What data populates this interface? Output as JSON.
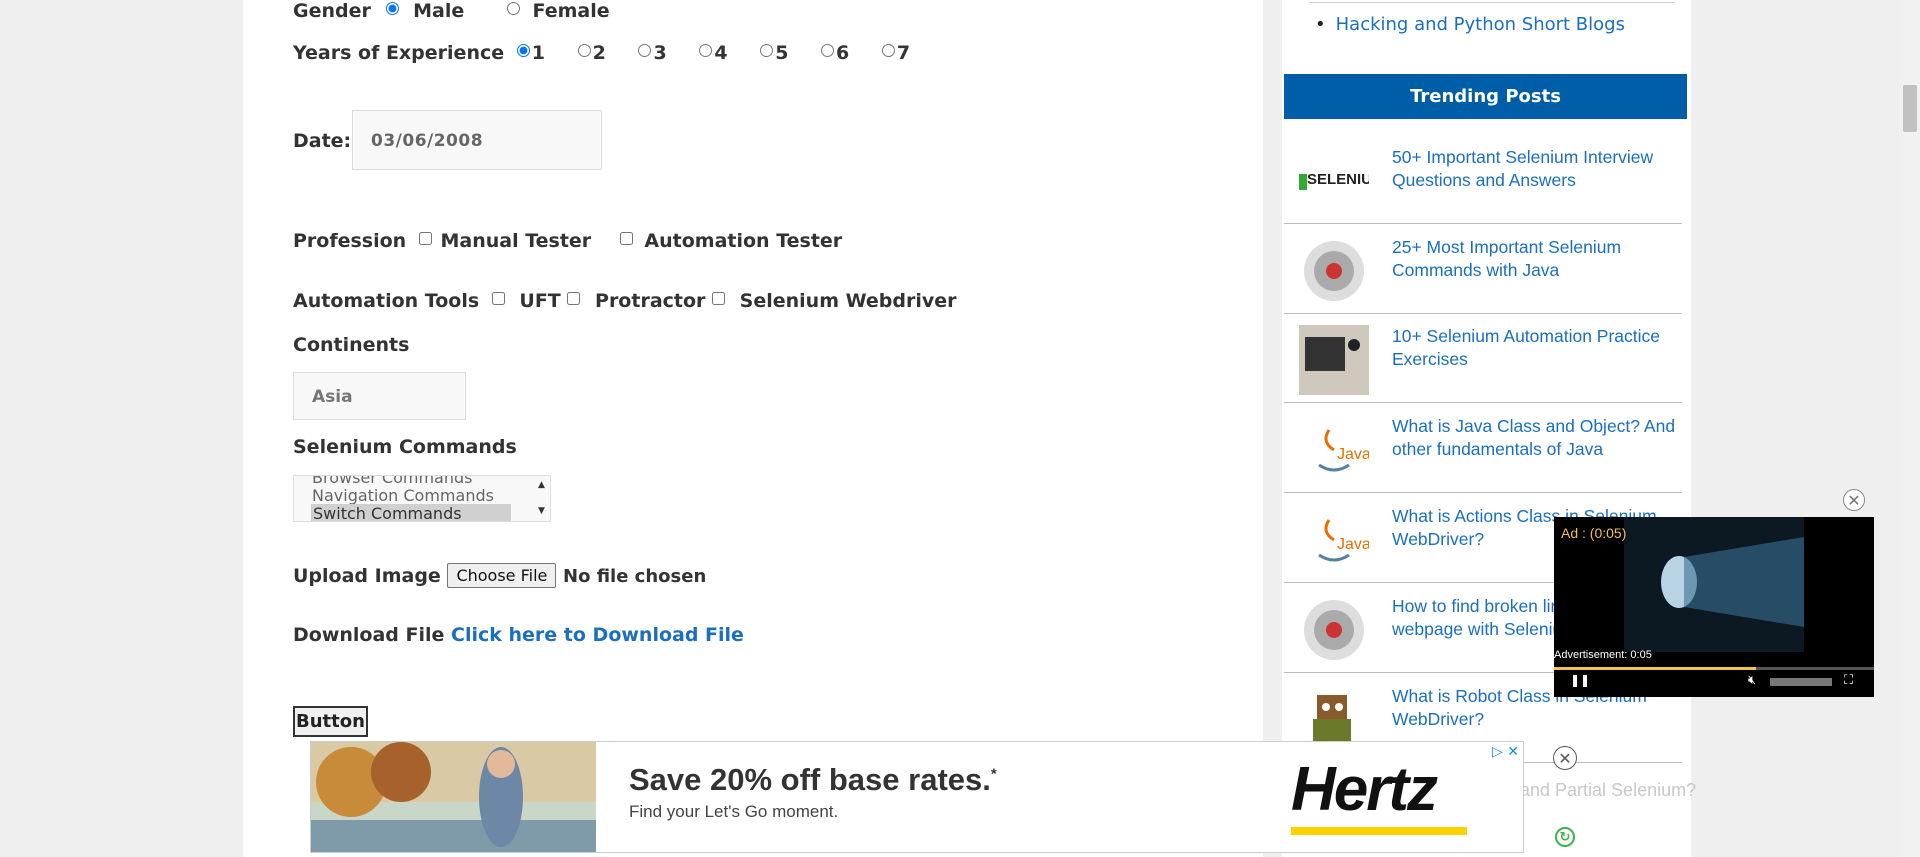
{
  "form": {
    "gender": {
      "label": "Gender",
      "options": [
        "Male",
        "Female"
      ],
      "selected": "Male"
    },
    "experience": {
      "label": "Years of Experience",
      "options": [
        "1",
        "2",
        "3",
        "4",
        "5",
        "6",
        "7"
      ],
      "selected": "1"
    },
    "date": {
      "label": "Date:",
      "value": "03/06/2008"
    },
    "profession": {
      "label": "Profession",
      "options": [
        "Manual Tester",
        "Automation Tester"
      ]
    },
    "automation_tools": {
      "label": "Automation Tools",
      "options": [
        "UFT",
        "Protractor",
        "Selenium Webdriver"
      ]
    },
    "continents": {
      "label": "Continents",
      "value": "Asia"
    },
    "selenium_commands": {
      "label": "Selenium Commands",
      "items": [
        "Browser Commands",
        "Navigation Commands",
        "Switch Commands"
      ],
      "selected": "Switch Commands"
    },
    "upload": {
      "label": "Upload Image",
      "button": "Choose File",
      "status": "No file chosen"
    },
    "download": {
      "label": "Download File",
      "link": "Click here to Download File"
    },
    "button": {
      "label": "Button"
    }
  },
  "sidebar": {
    "top_link": "Hacking and Python Short Blogs",
    "trending_title": "Trending Posts",
    "posts": [
      {
        "title": "50+ Important Selenium Interview Questions and Answers",
        "thumb": "selenium-logo-thumb"
      },
      {
        "title": "25+ Most Important Selenium Commands with Java",
        "thumb": "gear-thumb"
      },
      {
        "title": "10+ Selenium Automation Practice Exercises",
        "thumb": "laptop-thumb"
      },
      {
        "title": "What is Java Class and Object? And other fundamentals of Java",
        "thumb": "java-thumb"
      },
      {
        "title": "What is Actions Class in Selenium WebDriver?",
        "thumb": "selenium-java-thumb"
      },
      {
        "title": "How to find broken links in a webpage with Selenium?",
        "thumb": "gear-thumb"
      },
      {
        "title": "What is Robot Class in Selenium WebDriver?",
        "thumb": "robot-thumb"
      }
    ],
    "ghost_text": "and Partial Selenium?"
  },
  "video_ad": {
    "label": "Ad : (0:05)",
    "advertisement": "Advertisement: 0:05",
    "progress": 0.63
  },
  "bottom_ad": {
    "headline": "Save 20% off base rates.",
    "asterisk": "*",
    "subline": "Find your Let's Go moment.",
    "brand": "Hertz"
  },
  "colors": {
    "trending_header": "#005ea8",
    "link": "#1a6fbf",
    "ad_yellow": "#ffd100"
  }
}
